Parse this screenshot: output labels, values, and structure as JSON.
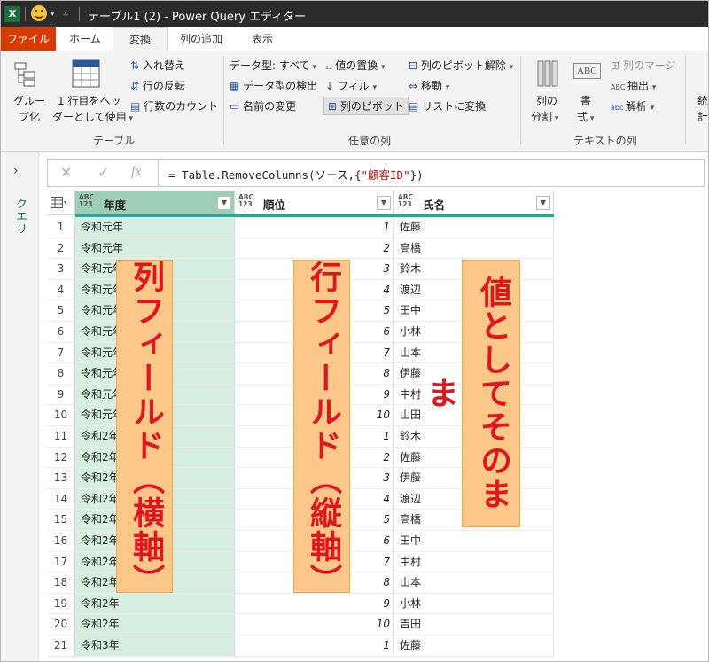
{
  "titlebar": {
    "app_icon": "X",
    "title": "テーブル1 (2) - Power Query エディター"
  },
  "tabs": [
    "ファイル",
    "ホーム",
    "変換",
    "列の追加",
    "表示"
  ],
  "active_tab": "変換",
  "ribbon": {
    "table_group": {
      "group_by_1": "グルー",
      "group_by_2": "プ化",
      "use_first_row_1": "1 行目をヘッ",
      "use_first_row_2": "ダーとして使用",
      "transpose": "入れ替え",
      "reverse_rows": "行の反転",
      "count_rows": "行数のカウント",
      "label": "テーブル"
    },
    "any_column_group": {
      "data_type": "データ型: すべて",
      "detect_type": "データ型の検出",
      "rename": "名前の変更",
      "replace_values": "値の置換",
      "fill": "フィル",
      "pivot": "列のピボット",
      "unpivot": "列のピボット解除",
      "move": "移動",
      "to_list": "リストに変換",
      "label": "任意の列"
    },
    "text_group": {
      "split_1": "列の",
      "split_2": "分割",
      "format_1": "書",
      "format_2": "式",
      "merge": "列のマージ",
      "extract": "抽出",
      "parse": "解析",
      "label": "テキストの列"
    },
    "partial_1": "統",
    "partial_2": "計"
  },
  "left_pane": {
    "label": "クエリ"
  },
  "formula_bar": {
    "x": "✕",
    "check": "✓",
    "fx": "fx",
    "prefix": "= Table.RemoveColumns(ソース,{",
    "string": "\"顧客ID\"",
    "suffix": "})"
  },
  "grid": {
    "type_badge": "ABC 123",
    "columns": [
      "年度",
      "順位",
      "氏名"
    ],
    "rows": [
      [
        "1",
        "令和元年",
        "1",
        "佐藤"
      ],
      [
        "2",
        "令和元年",
        "2",
        "高橋"
      ],
      [
        "3",
        "令和元年",
        "3",
        "鈴木"
      ],
      [
        "4",
        "令和元年",
        "4",
        "渡辺"
      ],
      [
        "5",
        "令和元年",
        "5",
        "田中"
      ],
      [
        "6",
        "令和元年",
        "6",
        "小林"
      ],
      [
        "7",
        "令和元年",
        "7",
        "山本"
      ],
      [
        "8",
        "令和元年",
        "8",
        "伊藤"
      ],
      [
        "9",
        "令和元年",
        "9",
        "中村"
      ],
      [
        "10",
        "令和元年",
        "10",
        "山田"
      ],
      [
        "11",
        "令和2年",
        "1",
        "鈴木"
      ],
      [
        "12",
        "令和2年",
        "2",
        "佐藤"
      ],
      [
        "13",
        "令和2年",
        "3",
        "伊藤"
      ],
      [
        "14",
        "令和2年",
        "4",
        "渡辺"
      ],
      [
        "15",
        "令和2年",
        "5",
        "高橋"
      ],
      [
        "16",
        "令和2年",
        "6",
        "田中"
      ],
      [
        "17",
        "令和2年",
        "7",
        "中村"
      ],
      [
        "18",
        "令和2年",
        "8",
        "山本"
      ],
      [
        "19",
        "令和2年",
        "9",
        "小林"
      ],
      [
        "20",
        "令和2年",
        "10",
        "吉田"
      ],
      [
        "21",
        "令和3年",
        "1",
        "佐藤"
      ]
    ]
  },
  "callouts": {
    "column_field": "列フィールド（横軸）",
    "row_field": "行フィールド（縦軸）",
    "values": "値としてそのまま"
  }
}
